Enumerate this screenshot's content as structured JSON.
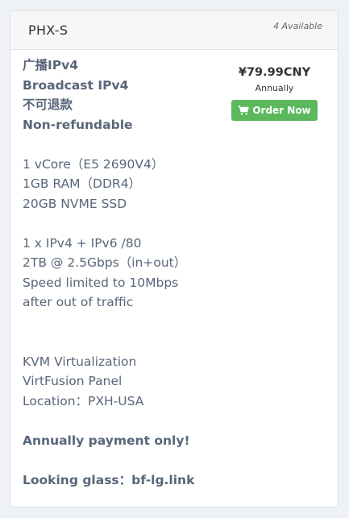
{
  "product": {
    "name": "PHX-S",
    "availability": "4 Available",
    "price": "¥79.99CNY",
    "billing_cycle": "Annually",
    "order_button_label": "Order Now"
  },
  "description": {
    "headline_lines": [
      "广播IPv4",
      "Broadcast IPv4",
      "不可退款",
      "Non-refundable"
    ],
    "hardware_lines": [
      "1 vCore（E5 2690V4）",
      "1GB RAM（DDR4）",
      "20GB NVME SSD"
    ],
    "network_lines": [
      "1 x IPv4 + IPv6 /80",
      "2TB @ 2.5Gbps（in+out）",
      "Speed limited to 10Mbps",
      "after out of traffic"
    ],
    "platform_lines": [
      "KVM Virtualization",
      "VirtFusion Panel",
      "Location：PXH-USA"
    ],
    "payment_note": "Annually payment only!",
    "looking_glass": "Looking glass：bf-lg.link"
  },
  "colors": {
    "order_button": "#5cb85c",
    "description_text": "#58667a",
    "page_background": "#eef1f6"
  },
  "icons": {
    "order_button_icon": "shopping-cart-icon"
  }
}
